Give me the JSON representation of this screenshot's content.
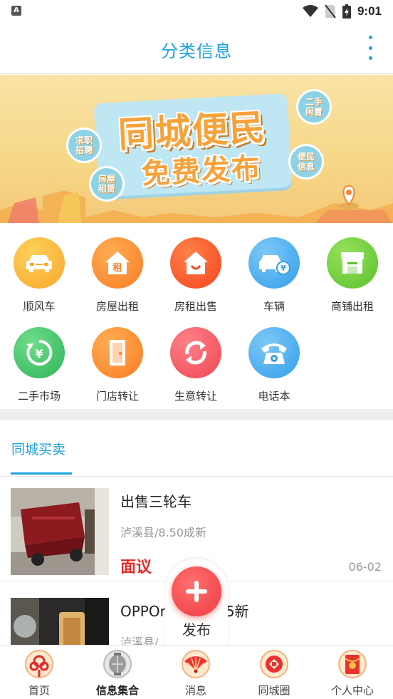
{
  "status_bar": {
    "time": "9:01",
    "indicator": "A"
  },
  "header": {
    "title": "分类信息"
  },
  "banner": {
    "line1": "同城便民",
    "line2": "免费发布",
    "bubbles": [
      "求职\n招聘",
      "房屋\n租赁",
      "二手\n闲置",
      "便民\n信息"
    ]
  },
  "categories": [
    {
      "label": "顺风车",
      "icon": "car-icon",
      "color": "#fbb43a"
    },
    {
      "label": "房屋出租",
      "icon": "house-rent-icon",
      "color": "#fb8e32"
    },
    {
      "label": "房租出售",
      "icon": "house-icon",
      "color": "#fb5d2e"
    },
    {
      "label": "车辆",
      "icon": "car-yuan-icon",
      "color": "#41aef0"
    },
    {
      "label": "商铺出租",
      "icon": "shop-icon",
      "color": "#6fcf3a"
    },
    {
      "label": "二手市场",
      "icon": "recycle-yuan-icon",
      "color": "#3fc366"
    },
    {
      "label": "门店转让",
      "icon": "door-icon",
      "color": "#fb8e32"
    },
    {
      "label": "生意转让",
      "icon": "transfer-icon",
      "color": "#f5555f"
    },
    {
      "label": "电话本",
      "icon": "phone-icon",
      "color": "#41a5f0"
    }
  ],
  "section": {
    "tab_label": "同城买卖"
  },
  "listings": [
    {
      "title": "出售三轮车",
      "meta": "泸溪县/8.50成新",
      "price": "面议",
      "date": "06-02"
    },
    {
      "title": "OPPOr",
      "title_suffix": "5新",
      "meta": "泸溪县/"
    }
  ],
  "fab": {
    "label": "发布"
  },
  "bottom_nav": [
    {
      "label": "首页",
      "icon": "chinese-knot-icon",
      "active": false
    },
    {
      "label": "信息集合",
      "icon": "lantern-icon",
      "active": true
    },
    {
      "label": "消息",
      "icon": "fan-icon",
      "active": false
    },
    {
      "label": "同城圈",
      "icon": "coin-icon",
      "active": false
    },
    {
      "label": "个人中心",
      "icon": "red-envelope-icon",
      "active": false
    }
  ]
}
